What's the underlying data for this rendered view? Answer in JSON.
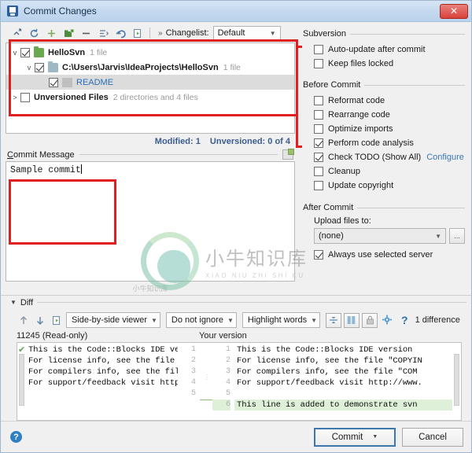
{
  "window": {
    "title": "Commit Changes",
    "title_icon": "idea-app-icon",
    "close_label": "✕"
  },
  "toolbar": {
    "buttons": [
      {
        "name": "expand-all-icon",
        "label": ""
      },
      {
        "name": "refresh-icon",
        "label": ""
      },
      {
        "name": "add-icon",
        "label": ""
      },
      {
        "name": "new-changelist-icon",
        "label": ""
      },
      {
        "name": "remove-icon",
        "label": ""
      },
      {
        "name": "move-to-changelist-icon",
        "label": ""
      },
      {
        "name": "rollback-icon",
        "label": ""
      },
      {
        "name": "show-diff-icon",
        "label": ""
      }
    ],
    "changelist_label": "Changelist:",
    "changelist_value": "Default"
  },
  "tree": {
    "rows": [
      {
        "indent": 0,
        "twisty": "v",
        "checked": true,
        "icon": "folder-green-icon",
        "label": "HelloSvn",
        "meta": "1 file",
        "selected": false,
        "link": false
      },
      {
        "indent": 1,
        "twisty": "v",
        "checked": true,
        "icon": "folder-icon",
        "label": "C:\\Users\\Jarvis\\IdeaProjects\\HelloSvn",
        "meta": "1 file",
        "selected": false,
        "link": false
      },
      {
        "indent": 2,
        "twisty": "",
        "checked": true,
        "icon": "file-icon",
        "label": "README",
        "meta": "",
        "selected": true,
        "link": true
      },
      {
        "indent": 0,
        "twisty": ">",
        "checked": false,
        "icon": "none",
        "label": "Unversioned Files",
        "meta": "2 directories and 4 files",
        "selected": false,
        "link": false
      }
    ]
  },
  "status": {
    "modified": "Modified: 1",
    "unversioned": "Unversioned: 0 of 4"
  },
  "commit_message": {
    "title": "Commit Message",
    "history_icon": "commit-history-icon",
    "value": "Sample commit",
    "placeholder": ""
  },
  "options": {
    "subversion": {
      "title": "Subversion",
      "items": [
        {
          "label": "Auto-update after commit",
          "checked": false,
          "name": "auto-update-after-commit"
        },
        {
          "label": "Keep files locked",
          "checked": false,
          "name": "keep-files-locked"
        }
      ]
    },
    "before_commit": {
      "title": "Before Commit",
      "items": [
        {
          "label": "Reformat code",
          "checked": false,
          "name": "reformat-code"
        },
        {
          "label": "Rearrange code",
          "checked": false,
          "name": "rearrange-code"
        },
        {
          "label": "Optimize imports",
          "checked": false,
          "name": "optimize-imports"
        },
        {
          "label": "Perform code analysis",
          "checked": true,
          "name": "perform-code-analysis"
        },
        {
          "label": "Check TODO (Show All)",
          "checked": true,
          "name": "check-todo",
          "link": "Configure"
        },
        {
          "label": "Cleanup",
          "checked": false,
          "name": "cleanup"
        },
        {
          "label": "Update copyright",
          "checked": false,
          "name": "update-copyright"
        }
      ]
    },
    "after_commit": {
      "title": "After Commit",
      "upload_label": "Upload files to:",
      "upload_value": "(none)",
      "browse_label": "...",
      "always_use": {
        "label": "Always use selected server",
        "checked": true
      }
    }
  },
  "diff": {
    "section_title": "Diff",
    "prev_icon": "arrow-up-icon",
    "next_icon": "arrow-down-icon",
    "jump_icon": "jump-to-source-icon",
    "viewer_mode": "Side-by-side viewer",
    "ignore_mode": "Do not ignore",
    "highlight_mode": "Highlight words",
    "collapse_icon": "collapse-unchanged-icon",
    "columns_icon": "synchronize-scrolling-icon",
    "lock_icon": "read-only-lock-icon",
    "settings_icon": "gear-icon",
    "help_icon": "question-mark-icon",
    "difference_count": "1 difference",
    "left_title": "11245 (Read-only)",
    "right_title": "Your version",
    "left_lines": [
      {
        "num": "1",
        "text": "This is the Code::Blocks IDE versio",
        "added": false
      },
      {
        "num": "2",
        "text": "For license info, see the file \"COP",
        "added": false
      },
      {
        "num": "3",
        "text": "For compilers info, see the file \"C",
        "added": false
      },
      {
        "num": "4",
        "text": "For support/feedback visit http://w",
        "added": false
      },
      {
        "num": "5",
        "text": "",
        "added": false
      }
    ],
    "right_lines": [
      {
        "num": "1",
        "text": "This is the Code::Blocks IDE version",
        "added": false
      },
      {
        "num": "2",
        "text": "For license info, see the file \"COPYIN",
        "added": false
      },
      {
        "num": "3",
        "text": "For compilers info, see the file \"COM",
        "added": false
      },
      {
        "num": "4",
        "text": "For support/feedback visit http://www.",
        "added": false
      },
      {
        "num": "5",
        "text": "",
        "added": false
      },
      {
        "num": "6",
        "text": "This line is added to demonstrate svn",
        "added": true
      }
    ]
  },
  "footer": {
    "help_label": "?",
    "commit_label": "Commit",
    "commit_split_icon": "chevron-down-icon",
    "cancel_label": "Cancel"
  },
  "watermark": {
    "cn": "小牛知识库",
    "en": "XIAO NIU ZHI SHI KU",
    "sub": "小牛知识库"
  },
  "colors": {
    "accent": "#3c78ab",
    "annotation": "#e02020",
    "added": "#dff0d8",
    "link": "#2a6fb8"
  }
}
